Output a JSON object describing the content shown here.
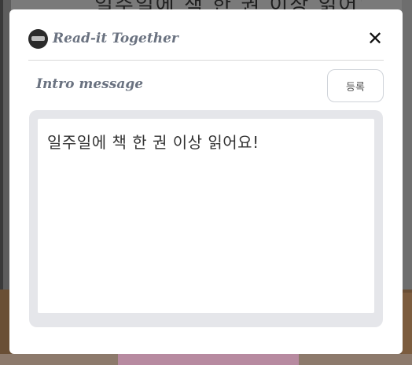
{
  "modal": {
    "app_title": "Read-it Together",
    "close_label": "✕",
    "section_title": "Intro message",
    "register_label": "등록",
    "message_text": "일주일에 책 한 권 이상 읽어요!"
  },
  "background": {
    "heading_text": "일주일에 책 한 권 이상 읽어요!"
  }
}
